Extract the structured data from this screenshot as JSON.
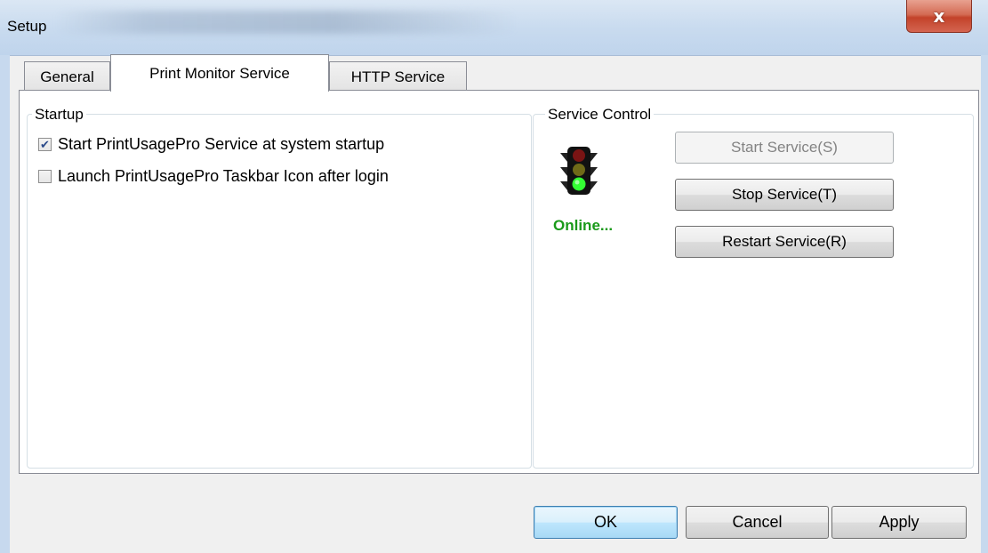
{
  "window": {
    "title": "Setup",
    "close_label": "x"
  },
  "tabs": [
    {
      "label": "General"
    },
    {
      "label": "Print Monitor Service"
    },
    {
      "label": "HTTP Service"
    }
  ],
  "startup": {
    "group_label": "Startup",
    "options": [
      {
        "label": "Start PrintUsagePro Service at system startup",
        "checked": true
      },
      {
        "label": "Launch PrintUsagePro Taskbar Icon after login",
        "checked": false
      }
    ]
  },
  "service_control": {
    "group_label": "Service Control",
    "status": "Online...",
    "status_color": "#1a9a1a",
    "traffic_light_icon": "traffic-light-icon",
    "start_label": "Start Service(S)",
    "stop_label": "Stop Service(T)",
    "restart_label": "Restart Service(R)"
  },
  "footer": {
    "ok_label": "OK",
    "cancel_label": "Cancel",
    "apply_label": "Apply"
  }
}
